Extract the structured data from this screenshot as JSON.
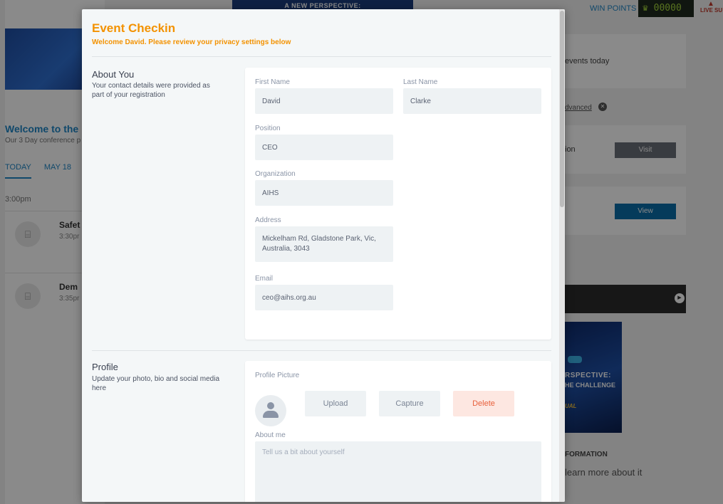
{
  "background": {
    "top_banner": "A NEW PERSPECTIVE:",
    "welcome_title": "Welcome to the",
    "welcome_sub": "Our 3 Day conference p",
    "tabs": [
      "TODAY",
      "MAY 18"
    ],
    "time_label": "3:00pm",
    "sessions": [
      {
        "title": "Safet",
        "time": "3:30pr"
      },
      {
        "title": "Dem",
        "time": "3:35pr"
      }
    ],
    "win_points_label": "WIN POINTS",
    "points_value": "00000",
    "live_label": "LIVE SU",
    "events_text": "events today",
    "advanced_link": "dvanced",
    "card2_text": "ion",
    "visit_label": "Visit",
    "view_label": "View",
    "poster": {
      "line1": "RSPECTIVE:",
      "line2": "HE CHALLENGE",
      "line3": "UAL"
    },
    "info_title": "FORMATION",
    "info_text": "learn more about it",
    "colors": {
      "accent": "#1f86c6",
      "visit_button": "#6a6f78",
      "view_button": "#0b6ea8"
    }
  },
  "modal": {
    "title": "Event Checkin",
    "subtitle": "Welcome David. Please review your privacy settings below",
    "accent_color": "#f39200",
    "about_you": {
      "title": "About You",
      "description": "Your contact details were provided as part of your registration",
      "fields": {
        "first_name": {
          "label": "First Name",
          "value": "David"
        },
        "last_name": {
          "label": "Last Name",
          "value": "Clarke"
        },
        "position": {
          "label": "Position",
          "value": "CEO"
        },
        "organization": {
          "label": "Organization",
          "value": "AIHS"
        },
        "address": {
          "label": "Address",
          "value": "Mickelham Rd, Gladstone Park, Vic, Australia, 3043"
        },
        "email": {
          "label": "Email",
          "value": "ceo@aihs.org.au"
        }
      }
    },
    "profile": {
      "title": "Profile",
      "description": "Update your photo, bio and social media here",
      "picture_label": "Profile Picture",
      "upload_label": "Upload",
      "capture_label": "Capture",
      "delete_label": "Delete",
      "about_label": "About me",
      "about_placeholder": "Tell us a bit about yourself"
    }
  }
}
